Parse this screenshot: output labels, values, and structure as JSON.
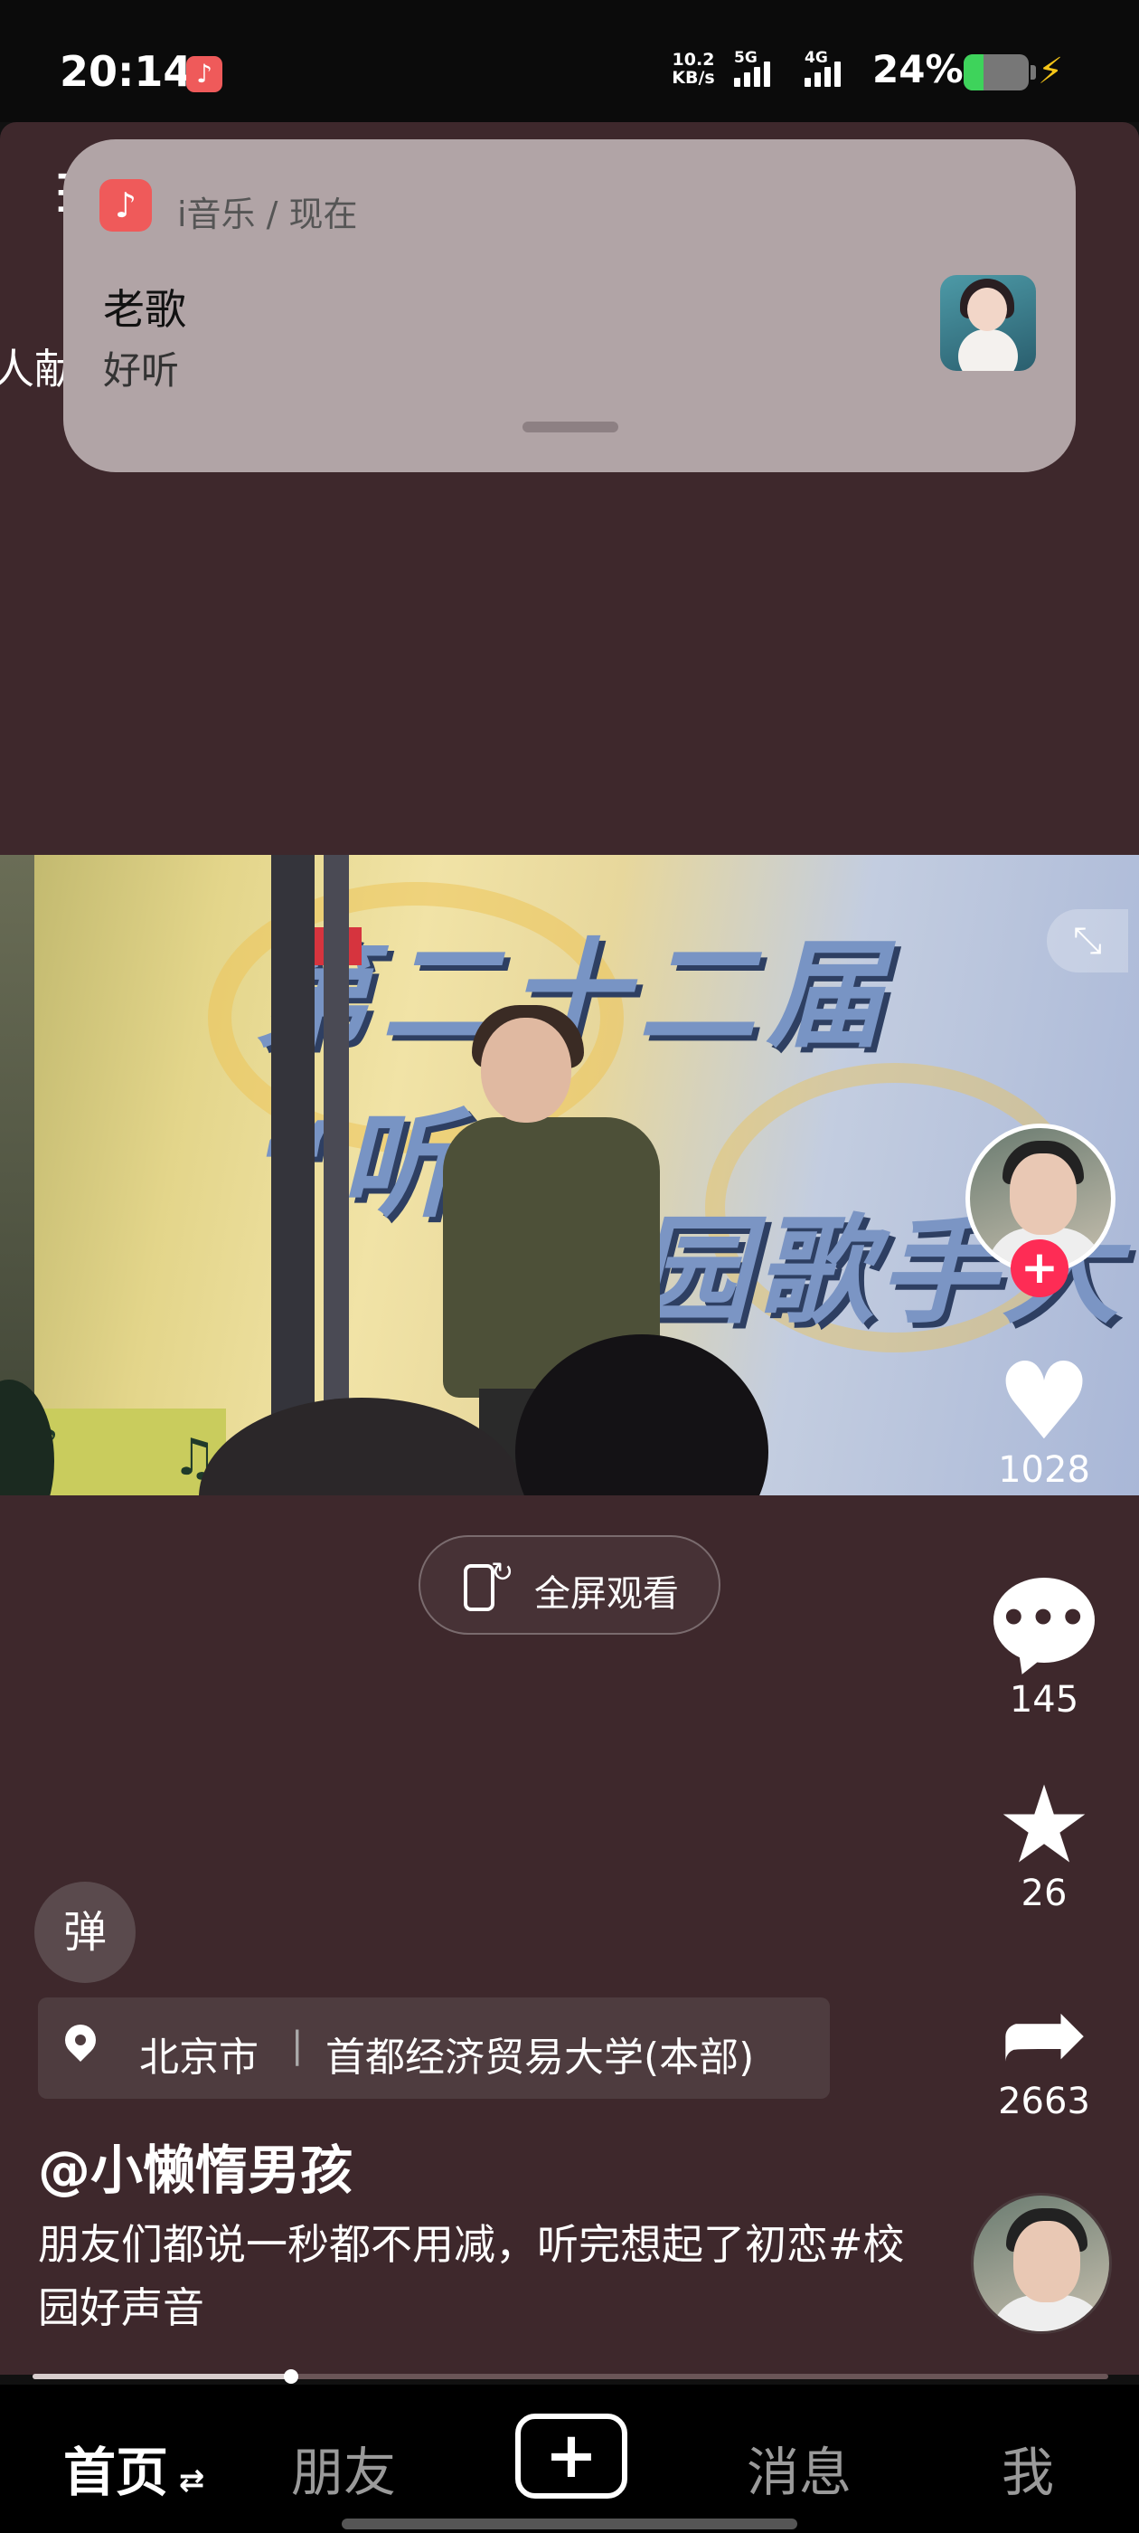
{
  "status_bar": {
    "time": "20:14",
    "net_speed": "10.2 KB/s",
    "signal_5g": "5G",
    "signal_4g": "4G",
    "battery_percent": "24%"
  },
  "notification": {
    "app_name": "i音乐 / 现在",
    "title": "老歌",
    "text": "好听",
    "accent_color": "#ef5a5a"
  },
  "edge_text": "人献",
  "video": {
    "banner_top": "第二十二届 “听",
    "banner_bottom": "园歌手大"
  },
  "fullscreen_label": "全屏观看",
  "actions": {
    "like_count": "1028",
    "comment_count": "145",
    "favorite_count": "26",
    "share_count": "2663",
    "follow_color": "#fe2c55"
  },
  "danmaku_label": "弹",
  "location": {
    "city": "北京市",
    "place": "首都经济贸易大学(本部)"
  },
  "author": "@小懒惰男孩",
  "caption": "朋友们都说一秒都不用减，听完想起了初恋#校园好声音",
  "progress_fraction": 0.24,
  "tabs": {
    "home": "首页",
    "friends": "朋友",
    "create": "+",
    "messages": "消息",
    "me": "我"
  }
}
